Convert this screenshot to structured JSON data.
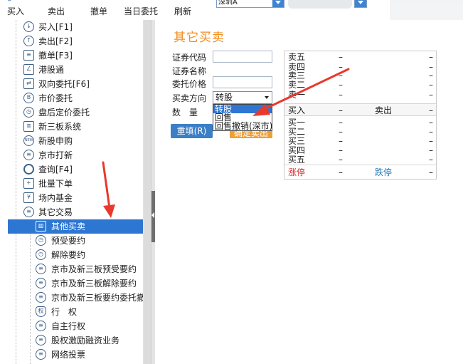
{
  "toolbar": {
    "buy": "买入",
    "sell": "卖出",
    "cancel": "撤单",
    "today_orders": "当日委托",
    "refresh": "刷新",
    "market_value": "深圳A"
  },
  "sidebar": {
    "items": [
      {
        "label": "买入[F1]",
        "icon": "buy-icon"
      },
      {
        "label": "卖出[F2]",
        "icon": "sell-icon"
      },
      {
        "label": "撤单[F3]",
        "icon": "cancel-order-icon"
      },
      {
        "label": "港股通",
        "icon": "hk-connect-icon"
      },
      {
        "label": "双向委托[F6]",
        "icon": "two-way-order-icon"
      },
      {
        "label": "市价委托",
        "icon": "market-order-icon"
      },
      {
        "label": "盘后定价委托",
        "icon": "after-hours-icon"
      },
      {
        "label": "新三板系统",
        "icon": "neeq-icon"
      },
      {
        "label": "新股申购",
        "icon": "ipo-icon"
      },
      {
        "label": "京市打新",
        "icon": "beijing-ipo-icon"
      },
      {
        "label": "查询[F4]",
        "icon": "search-icon"
      },
      {
        "label": "批量下单",
        "icon": "batch-order-icon"
      },
      {
        "label": "场内基金",
        "icon": "fund-icon"
      },
      {
        "label": "其它交易",
        "icon": "other-trade-icon"
      },
      {
        "label": "其他买卖",
        "icon": "chart-icon"
      },
      {
        "label": "预受要约",
        "icon": "clock-icon"
      },
      {
        "label": "解除要约",
        "icon": "clock-icon"
      },
      {
        "label": "京市及新三板预受要约",
        "icon": "list-icon"
      },
      {
        "label": "京市及新三板解除要约",
        "icon": "list-icon"
      },
      {
        "label": "京市及新三板要约委托撤",
        "icon": "list-icon"
      },
      {
        "label": "行　权",
        "icon": "shield-icon"
      },
      {
        "label": "自主行权",
        "icon": "list-icon"
      },
      {
        "label": "股权激励融资业务",
        "icon": "list-icon"
      },
      {
        "label": "网络投票",
        "icon": "list-icon"
      }
    ]
  },
  "form": {
    "title": "其它买卖",
    "code_label": "证券代码",
    "name_label": "证券名称",
    "price_label": "委托价格",
    "direction_label": "买卖方向",
    "qty_label": "数　量",
    "direction_value": "转股",
    "direction_options": [
      "转股",
      "回售",
      "回售撤销(深市)"
    ],
    "reset_label": "重填(R)",
    "confirm_label": "确定卖出"
  },
  "quote": {
    "sell_rows": [
      "卖五",
      "卖四",
      "卖三",
      "卖二",
      "卖一"
    ],
    "buy_rows": [
      "买一",
      "买二",
      "买三",
      "买四",
      "买五"
    ],
    "dash": "–",
    "buy_header": "买入",
    "sell_header": "卖出",
    "limit_up": "涨停",
    "limit_down": "跌停"
  },
  "colors": {
    "accent": "#2d76d2",
    "title": "#f28b1c",
    "limit_up": "#d9252b",
    "limit_down": "#2a7bb8",
    "annotation": "#e8392e"
  }
}
